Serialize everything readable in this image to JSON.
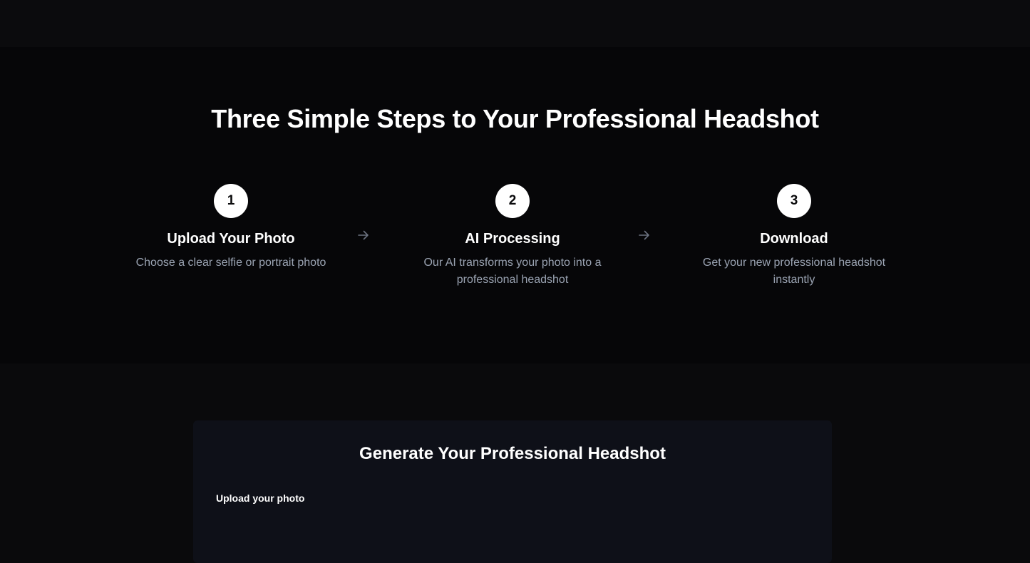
{
  "steps_section": {
    "title": "Three Simple Steps to Your Professional Headshot",
    "steps": [
      {
        "number": "1",
        "title": "Upload Your Photo",
        "description": "Choose a clear selfie or portrait photo"
      },
      {
        "number": "2",
        "title": "AI Processing",
        "description": "Our AI transforms your photo into a professional headshot"
      },
      {
        "number": "3",
        "title": "Download",
        "description": "Get your new professional headshot instantly"
      }
    ],
    "arrow_icon": "arrow-right-icon"
  },
  "generator": {
    "title": "Generate Your Professional Headshot",
    "upload_label": "Upload your photo"
  },
  "colors": {
    "background": "#0a0a0c",
    "section_background": "#060608",
    "card_background": "#0e1018",
    "muted_text": "#9aa3b2",
    "arrow": "#6b7280"
  }
}
